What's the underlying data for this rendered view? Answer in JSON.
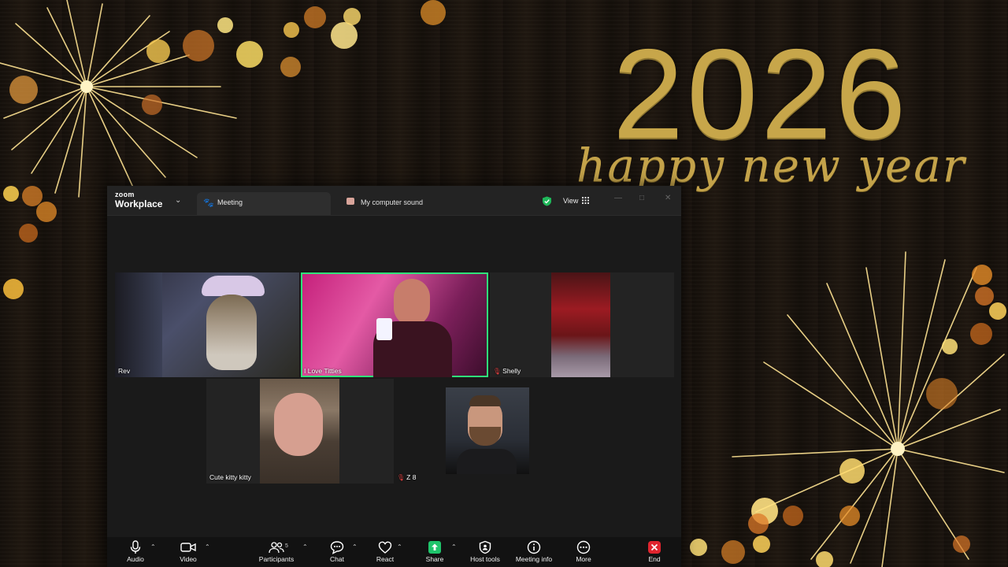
{
  "wallpaper": {
    "year": "2026",
    "greeting": "happy new year"
  },
  "app": {
    "brand_top": "zoom",
    "brand_bottom": "Workplace",
    "tab_meeting": "Meeting",
    "tab_sound": "My computer sound",
    "view_label": "View"
  },
  "participants": [
    {
      "name": "Rev",
      "muted": false,
      "active": false
    },
    {
      "name": "I Love Titties",
      "muted": false,
      "active": true
    },
    {
      "name": "Shelly",
      "muted": true,
      "active": false
    },
    {
      "name": "Cute kitty kitty",
      "muted": false,
      "active": false
    },
    {
      "name": "Z 8",
      "muted": true,
      "active": false
    },
    {
      "name": "",
      "muted": false,
      "active": false
    }
  ],
  "toolbar": {
    "audio": "Audio",
    "video": "Video",
    "participants": "Participants",
    "participants_count": "5",
    "chat": "Chat",
    "react": "React",
    "share": "Share",
    "host_tools": "Host tools",
    "meeting_info": "Meeting info",
    "more": "More",
    "end": "End"
  },
  "colors": {
    "active_speaker": "#2fe37a",
    "share_green": "#1fc46b",
    "end_red": "#e0242e",
    "gold": "#c7a64a"
  }
}
